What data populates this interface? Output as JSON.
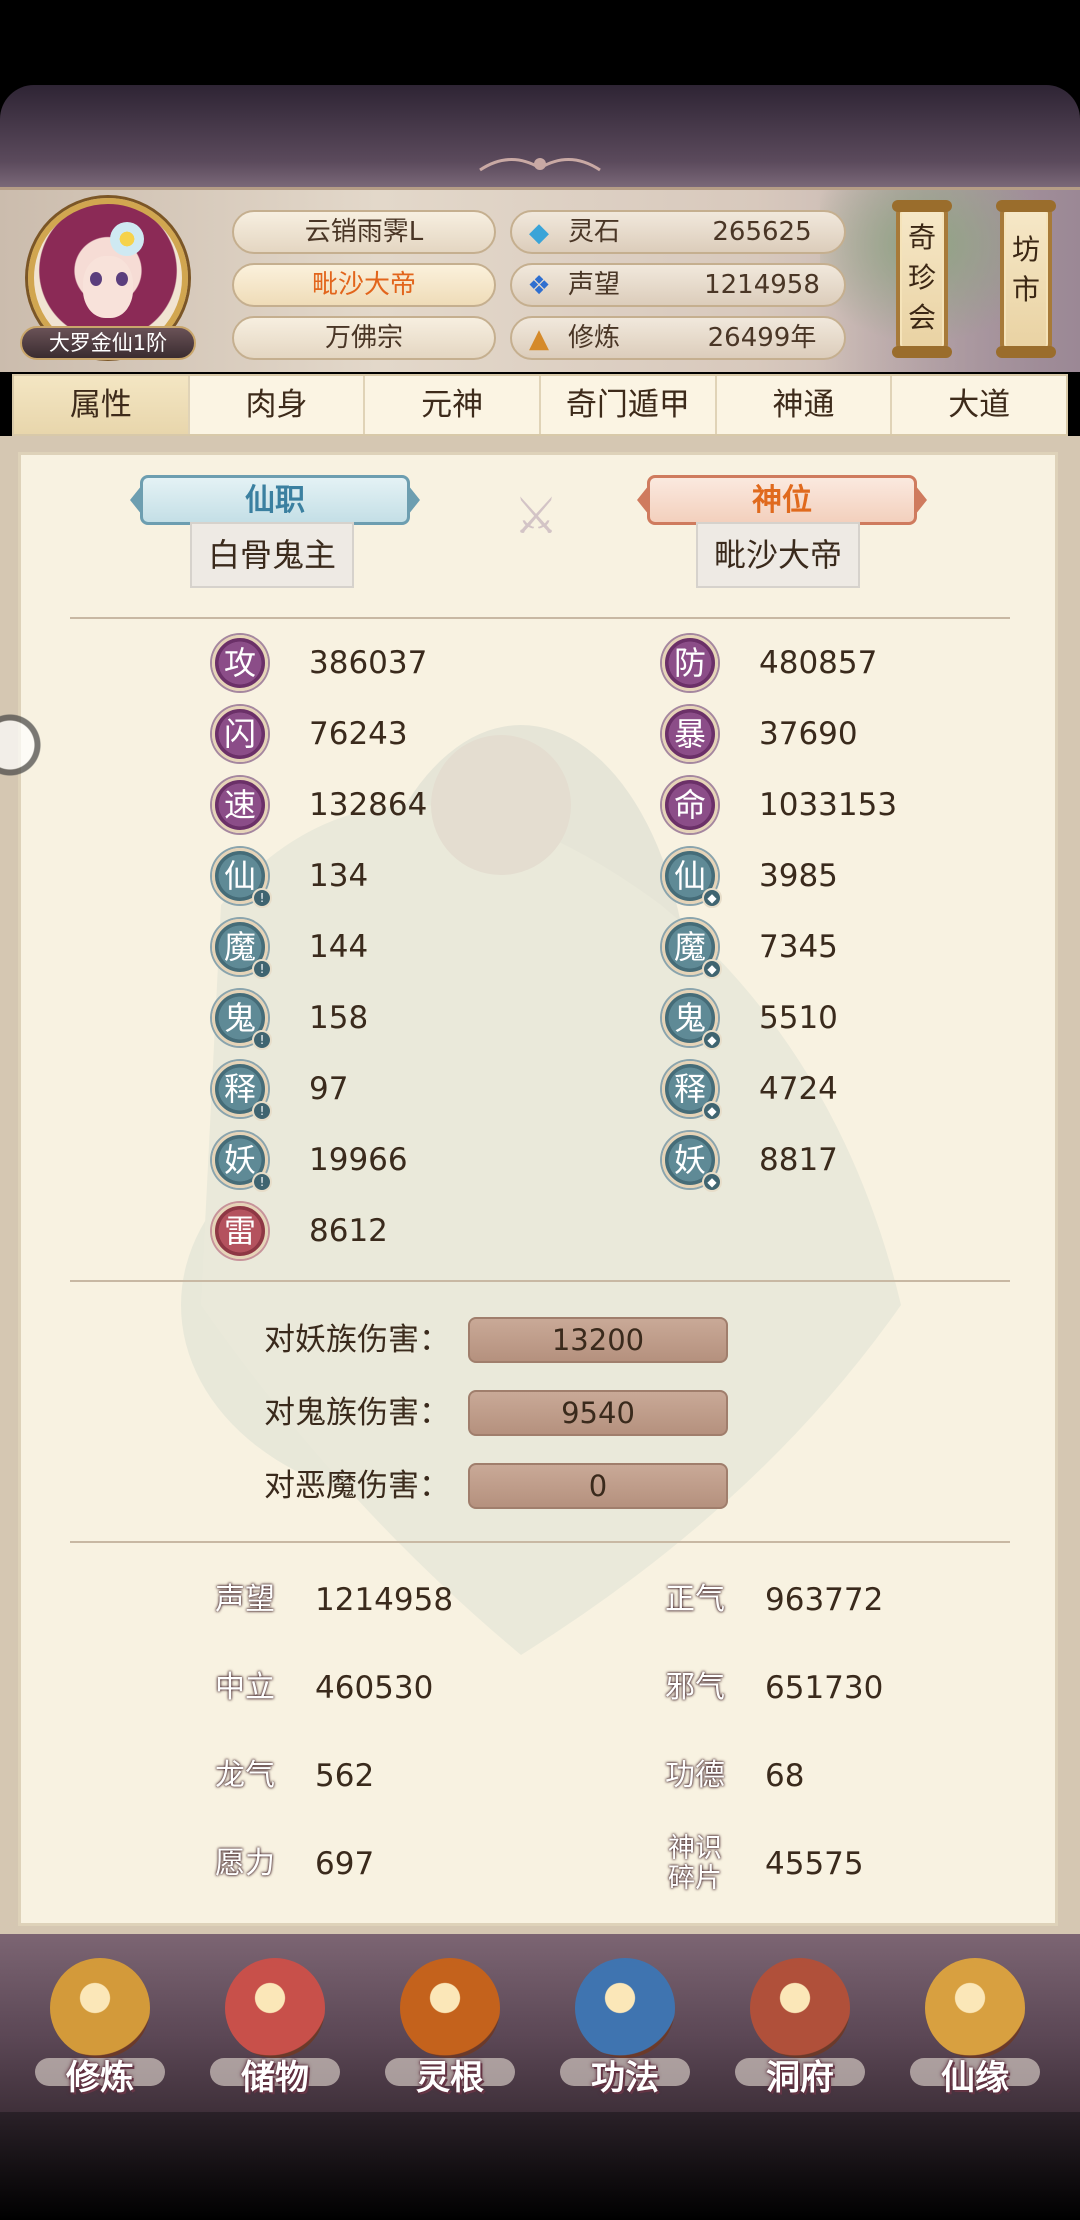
{
  "header": {
    "rank": "大罗金仙1阶",
    "name": "云销雨霁L",
    "title": "毗沙大帝",
    "sect": "万佛宗",
    "resources": [
      {
        "icon": "spirit-stone-icon",
        "glyph": "◆",
        "color": "#3aa4d8",
        "label": "灵石",
        "value": "265625"
      },
      {
        "icon": "reputation-icon",
        "glyph": "❖",
        "color": "#2f6fd0",
        "label": "声望",
        "value": "1214958"
      },
      {
        "icon": "cultivation-icon",
        "glyph": "▲",
        "color": "#d58a2a",
        "label": "修炼",
        "value": "26499年"
      }
    ],
    "lanterns": [
      "奇珍会",
      "坊市"
    ]
  },
  "tabs": [
    "属性",
    "肉身",
    "元神",
    "奇门遁甲",
    "神通",
    "大道"
  ],
  "titles": {
    "immortal_post_label": "仙职",
    "immortal_post_value": "白骨鬼主",
    "divine_rank_label": "神位",
    "divine_rank_value": "毗沙大帝"
  },
  "stats_left": [
    {
      "icon": "攻",
      "value": "386037",
      "style": "purple",
      "badge": ""
    },
    {
      "icon": "闪",
      "value": "76243",
      "style": "purple",
      "badge": ""
    },
    {
      "icon": "速",
      "value": "132864",
      "style": "purple",
      "badge": ""
    },
    {
      "icon": "仙",
      "value": "134",
      "style": "teal",
      "badge": "!"
    },
    {
      "icon": "魔",
      "value": "144",
      "style": "teal",
      "badge": "!"
    },
    {
      "icon": "鬼",
      "value": "158",
      "style": "teal",
      "badge": "!"
    },
    {
      "icon": "释",
      "value": "97",
      "style": "teal",
      "badge": "!"
    },
    {
      "icon": "妖",
      "value": "19966",
      "style": "teal",
      "badge": "!"
    },
    {
      "icon": "雷",
      "value": "8612",
      "style": "red",
      "badge": ""
    }
  ],
  "stats_right": [
    {
      "icon": "防",
      "value": "480857",
      "style": "purple",
      "badge": ""
    },
    {
      "icon": "暴",
      "value": "37690",
      "style": "purple",
      "badge": ""
    },
    {
      "icon": "命",
      "value": "1033153",
      "style": "purple",
      "badge": ""
    },
    {
      "icon": "仙",
      "value": "3985",
      "style": "teal",
      "badge": "◆"
    },
    {
      "icon": "魔",
      "value": "7345",
      "style": "teal",
      "badge": "◆"
    },
    {
      "icon": "鬼",
      "value": "5510",
      "style": "teal",
      "badge": "◆"
    },
    {
      "icon": "释",
      "value": "4724",
      "style": "teal",
      "badge": "◆"
    },
    {
      "icon": "妖",
      "value": "8817",
      "style": "teal",
      "badge": "◆"
    }
  ],
  "damage": [
    {
      "label": "对妖族伤害：",
      "value": "13200"
    },
    {
      "label": "对鬼族伤害：",
      "value": "9540"
    },
    {
      "label": "对恶魔伤害：",
      "value": "0"
    }
  ],
  "attributes_left": [
    {
      "icon": "声望",
      "value": "1214958"
    },
    {
      "icon": "中立",
      "value": "460530"
    },
    {
      "icon": "龙气",
      "value": "562"
    },
    {
      "icon": "愿力",
      "value": "697"
    }
  ],
  "attributes_right": [
    {
      "icon": "正气",
      "value": "963772"
    },
    {
      "icon": "邪气",
      "value": "651730"
    },
    {
      "icon": "功德",
      "value": "68"
    },
    {
      "icon": "神识碎片",
      "value": "45575"
    }
  ],
  "bottom_nav": [
    {
      "label": "修炼",
      "icon": "cultivate-icon",
      "color": "#d39a3a"
    },
    {
      "label": "储物",
      "icon": "storage-bag-icon",
      "color": "#c8504a"
    },
    {
      "label": "灵根",
      "icon": "spirit-root-icon",
      "color": "#c4621c"
    },
    {
      "label": "功法",
      "icon": "technique-book-icon",
      "color": "#3f74b0"
    },
    {
      "label": "洞府",
      "icon": "cave-abode-icon",
      "color": "#b0503a"
    },
    {
      "label": "仙缘",
      "icon": "immortal-fate-icon",
      "color": "#d8a040"
    }
  ]
}
